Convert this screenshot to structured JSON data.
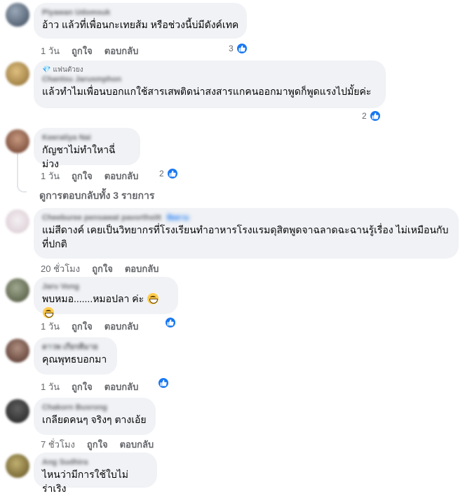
{
  "comments": [
    {
      "author": "Piyawan Udomsuk",
      "text": "อ้าว แล้วที่เพื่อนกะเทยส้ม หรือช่วงนี้บ่มีดังค์เทค",
      "time": "1 วัน",
      "like": "ถูกใจ",
      "reply": "ตอบกลับ",
      "reactions": "3"
    },
    {
      "badge": "แฟนตัวยง",
      "author": "Chantsu Jarusmphon",
      "text": "แล้วทำไมเพื่อนบอกแกใช้สารเสพติดน่าสงสารแกคนออกมาพูดก็พูดแรงไปมั้ยค่ะ",
      "reactions": "2"
    },
    {
      "author": "Keeratiya Nai",
      "text": "กัญชาไม่ทำใหาฉี่ม่วง",
      "time": "1 วัน",
      "like": "ถูกใจ",
      "reply": "ตอบกลับ",
      "reactions": "2"
    },
    {
      "author": "Cheeburee pensawat pavorthsitt",
      "tag": "ติดตาม",
      "text": "แม่สีดางค์ เคยเป็นวิทยากรที่โรงเรียนทำอาหารโรงแรมดุสิตพูดจาฉลาดฉะฉานรู้เรื่อง ไม่เหมือนกับที่ปกติ",
      "time": "20 ชั่วโมง",
      "like": "ถูกใจ",
      "reply": "ตอบกลับ"
    },
    {
      "author": "Jaru Vong",
      "text": "พบหมอ.......หมอปลา ค่ะ",
      "time": "1 วัน",
      "like": "ถูกใจ",
      "reply": "ตอบกลับ"
    },
    {
      "author": "ดาวพ เกียรติมาย",
      "text": "คุณพุทธบอกมา",
      "time": "1 วัน",
      "like": "ถูกใจ",
      "reply": "ตอบกลับ"
    },
    {
      "author": "Chakorn Busrong",
      "text": "เกลียดคนๆ จริงๆ ตางเอ้ย",
      "time": "7 ชั่วโมง",
      "like": "ถูกใจ",
      "reply": "ตอบกลับ"
    },
    {
      "author": "Ang Sudhira",
      "text": "ไหนว่ามีการใช้ใบไม่ร่าเริง"
    }
  ],
  "view_replies": "ดูการตอบกลับทั้ง 3 รายการ",
  "colors": {
    "bubble": "#f0f2f5",
    "meta": "#65676b",
    "like_blue": "#1877f2"
  }
}
